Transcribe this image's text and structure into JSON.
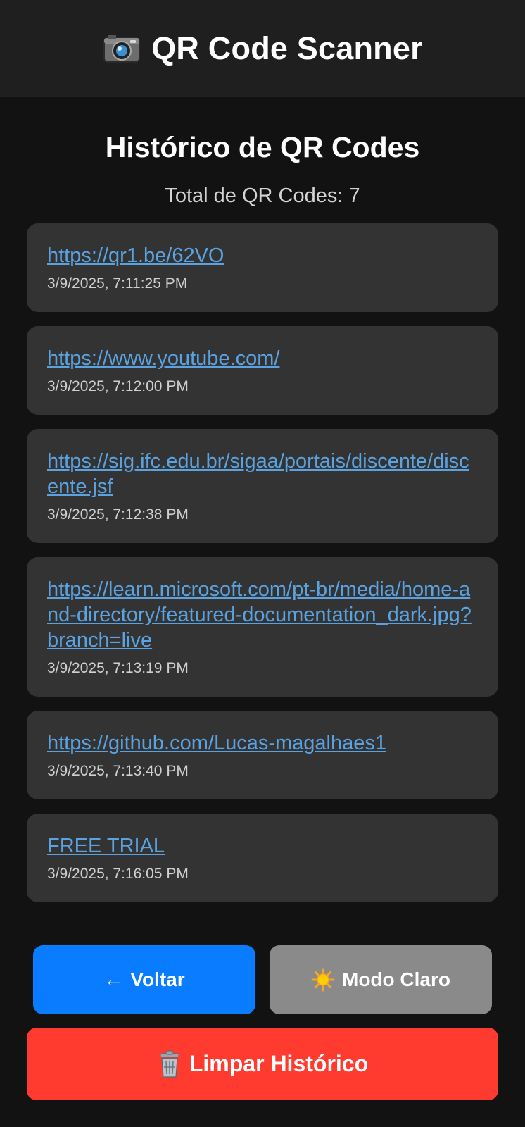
{
  "header": {
    "icon": "camera-icon",
    "title": "QR Code Scanner",
    "background": "#1f1f1f"
  },
  "history": {
    "title": "Histórico de QR Codes",
    "total_label": "Total de QR Codes: 7",
    "items": [
      {
        "url": "https://qr1.be/62VO",
        "date": "3/9/2025, 7:11:25 PM"
      },
      {
        "url": "https://www.youtube.com/",
        "date": "3/9/2025, 7:12:00 PM"
      },
      {
        "url": "https://sig.ifc.edu.br/sigaa/portais/discente/discente.jsf",
        "date": "3/9/2025, 7:12:38 PM"
      },
      {
        "url": "https://learn.microsoft.com/pt-br/media/home-and-directory/featured-documentation_dark.jpg?branch=live",
        "date": "3/9/2025, 7:13:19 PM"
      },
      {
        "url": "https://github.com/Lucas-magalhaes1",
        "date": "3/9/2025, 7:13:40 PM"
      },
      {
        "url": "FREE TRIAL",
        "date": "3/9/2025, 7:16:05 PM"
      }
    ]
  },
  "buttons": {
    "back": {
      "arrow": "←",
      "label": "Voltar",
      "color": "#0a7cff"
    },
    "theme": {
      "icon": "sun-icon",
      "label": "Modo Claro",
      "color": "#8a8a8a"
    },
    "clear": {
      "icon": "trash-icon",
      "label": "Limpar Histórico",
      "color": "#ff3b30"
    }
  },
  "colors": {
    "background": "#121212",
    "card": "#333333",
    "link": "#5aa2e0"
  }
}
